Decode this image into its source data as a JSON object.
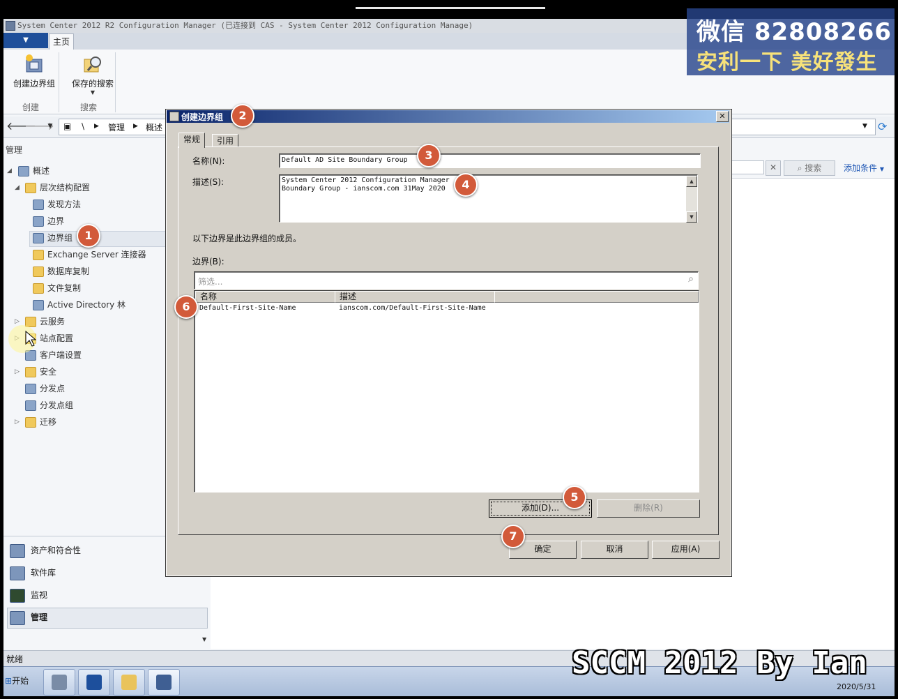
{
  "window": {
    "title": "System Center 2012 R2 Configuration Manager (已连接到 CAS - System Center 2012 Configuration Manage)"
  },
  "ribbon": {
    "home_tab": "主页",
    "buttons": [
      {
        "label": "创建边界组",
        "icon": "create-boundary-group-icon"
      },
      {
        "label": "保存的搜索",
        "icon": "saved-search-icon"
      }
    ],
    "groups": [
      "创建",
      "搜索"
    ]
  },
  "nav": {
    "path": [
      "\\",
      "管理",
      "概述"
    ]
  },
  "left_pane": {
    "title": "管理",
    "tree": [
      {
        "label": "概述",
        "level": 0,
        "icon": "overview-icon"
      },
      {
        "label": "层次结构配置",
        "level": 1,
        "icon": "folder-icon"
      },
      {
        "label": "发现方法",
        "level": 2,
        "icon": "discovery-icon"
      },
      {
        "label": "边界",
        "level": 2,
        "icon": "boundary-icon"
      },
      {
        "label": "边界组",
        "level": 2,
        "icon": "boundary-group-icon",
        "selected": true
      },
      {
        "label": "Exchange Server 连接器",
        "level": 2,
        "icon": "exchange-icon"
      },
      {
        "label": "数据库复制",
        "level": 2,
        "icon": "db-replication-icon"
      },
      {
        "label": "文件复制",
        "level": 2,
        "icon": "file-replication-icon"
      },
      {
        "label": "Active Directory 林",
        "level": 2,
        "icon": "ad-forest-icon"
      },
      {
        "label": "云服务",
        "level": 1,
        "icon": "folder-icon"
      },
      {
        "label": "站点配置",
        "level": 1,
        "icon": "folder-icon"
      },
      {
        "label": "客户端设置",
        "level": 1,
        "icon": "client-settings-icon"
      },
      {
        "label": "安全",
        "level": 1,
        "icon": "folder-icon"
      },
      {
        "label": "分发点",
        "level": 1,
        "icon": "distribution-point-icon"
      },
      {
        "label": "分发点组",
        "level": 1,
        "icon": "distribution-point-group-icon"
      },
      {
        "label": "迁移",
        "level": 1,
        "icon": "folder-icon"
      }
    ],
    "workspaces": [
      {
        "label": "资产和符合性",
        "icon": "assets-icon"
      },
      {
        "label": "软件库",
        "icon": "software-library-icon"
      },
      {
        "label": "监视",
        "icon": "monitoring-icon"
      },
      {
        "label": "管理",
        "icon": "administration-icon",
        "active": true
      }
    ]
  },
  "right_pane": {
    "search_button": "搜索",
    "add_criteria": "添加条件"
  },
  "status_bar": {
    "text": "就绪"
  },
  "dialog": {
    "title": "创建边界组",
    "tabs": [
      "常规",
      "引用"
    ],
    "name_label": "名称(N):",
    "name_value": "Default AD Site Boundary Group",
    "desc_label": "描述(S):",
    "desc_line1": "System Center 2012 Configuration Manager",
    "desc_line2": "Boundary Group -  ianscom.com 31May 2020",
    "members_text": "以下边界是此边界组的成员。",
    "boundaries_label": "边界(B):",
    "filter_placeholder": "筛选...",
    "columns": [
      "名称",
      "描述"
    ],
    "rows": [
      {
        "name": "Default-First-Site-Name",
        "description": "ianscom.com/Default-First-Site-Name"
      }
    ],
    "add_button": "添加(D)...",
    "remove_button": "删除(R)",
    "ok_button": "确定",
    "cancel_button": "取消",
    "apply_button": "应用(A)"
  },
  "callouts": [
    "1",
    "2",
    "3",
    "4",
    "5",
    "6",
    "7"
  ],
  "watermark": {
    "line1": "微信 82808266",
    "line2": "安利一下 美好發生",
    "bottom": "SCCM 2012 By Ian"
  },
  "taskbar": {
    "start": "开始",
    "date": "2020/5/31"
  },
  "colors": {
    "callout": "#d25a3a",
    "dialog_title_start": "#0a246a",
    "dialog_title_end": "#a6caf0",
    "link": "#1f57b5"
  }
}
